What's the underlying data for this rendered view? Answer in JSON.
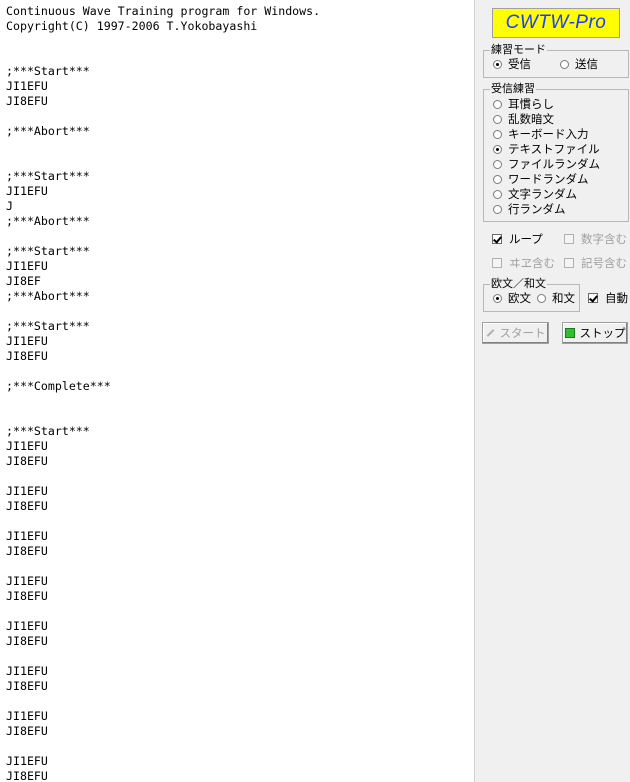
{
  "log": {
    "lines": [
      "Continuous Wave Training program for Windows.",
      "Copyright(C) 1997-2006 T.Yokobayashi",
      "",
      "",
      ";***Start***",
      "JI1EFU",
      "JI8EFU",
      "",
      ";***Abort***",
      "",
      "",
      ";***Start***",
      "JI1EFU",
      "J",
      ";***Abort***",
      "",
      ";***Start***",
      "JI1EFU",
      "JI8EF",
      ";***Abort***",
      "",
      ";***Start***",
      "JI1EFU",
      "JI8EFU",
      "",
      ";***Complete***",
      "",
      "",
      ";***Start***",
      "JI1EFU",
      "JI8EFU",
      "",
      "JI1EFU",
      "JI8EFU",
      "",
      "JI1EFU",
      "JI8EFU",
      "",
      "JI1EFU",
      "JI8EFU",
      "",
      "JI1EFU",
      "JI8EFU",
      "",
      "JI1EFU",
      "JI8EFU",
      "",
      "JI1EFU",
      "JI8EFU",
      "",
      "JI1EFU",
      "JI8EFU"
    ]
  },
  "panel": {
    "logo": "CWTW-Pro",
    "mode_group": {
      "title": "練習モード",
      "options": [
        {
          "label": "受信",
          "selected": true
        },
        {
          "label": "送信",
          "selected": false
        }
      ]
    },
    "receive_group": {
      "title": "受信練習",
      "options": [
        {
          "label": "耳慣らし",
          "selected": false
        },
        {
          "label": "乱数暗文",
          "selected": false
        },
        {
          "label": "キーボード入力",
          "selected": false
        },
        {
          "label": "テキストファイル",
          "selected": true
        },
        {
          "label": "ファイルランダム",
          "selected": false
        },
        {
          "label": "ワードランダム",
          "selected": false
        },
        {
          "label": "文字ランダム",
          "selected": false
        },
        {
          "label": "行ランダム",
          "selected": false
        }
      ]
    },
    "checks": {
      "loop": {
        "label": "ループ",
        "checked": true,
        "enabled": true
      },
      "digits": {
        "label": "数字含む",
        "checked": false,
        "enabled": false
      },
      "kana": {
        "label": "ヰヱ含む",
        "checked": false,
        "enabled": false
      },
      "symbols": {
        "label": "記号含む",
        "checked": false,
        "enabled": false
      }
    },
    "lang_group": {
      "title": "欧文／和文",
      "options": [
        {
          "label": "欧文",
          "selected": true
        },
        {
          "label": "和文",
          "selected": false
        }
      ]
    },
    "auto": {
      "label": "自動",
      "checked": true
    },
    "buttons": {
      "start": {
        "label": "スタート",
        "enabled": false
      },
      "stop": {
        "label": "ストップ",
        "enabled": true
      }
    },
    "colors": {
      "logo_bg": "#ffff00",
      "logo_text": "#1e3cff",
      "stop_icon": "#2fbf2f"
    }
  }
}
